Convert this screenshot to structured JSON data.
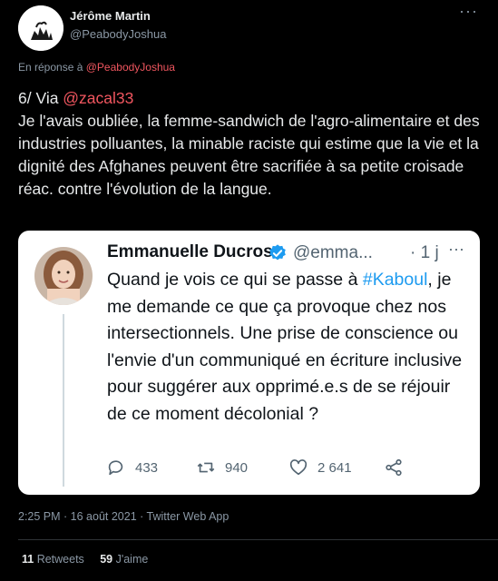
{
  "author": {
    "name": "Jérôme Martin",
    "handle": "@PeabodyJoshua"
  },
  "menu_glyph": "···",
  "reply": {
    "prefix": "En réponse à",
    "to": "@PeabodyJoshua"
  },
  "tweet": {
    "lead": "6/ Via ",
    "mention": "@zacal33",
    "body": "Je l'avais oubliée, la femme-sandwich de l'agro-alimentaire et des industries polluantes, la minable raciste qui estime que la vie et la dignité des Afghanes peuvent être sacrifiée à sa petite croisade réac. contre l'évolution de la langue."
  },
  "quoted": {
    "name": "Emmanuelle Ducros",
    "handle": "@emma...",
    "time": "· 1 j",
    "text_before": "Quand je vois ce qui se passe à ",
    "hashtag": "#Kaboul",
    "text_after": ", je me demande ce que ça provoque chez nos intersectionnels. Une prise de conscience ou l'envie d'un communiqué en écriture inclusive pour suggérer aux opprimé.e.s  de se réjouir de ce moment décolonial ?",
    "replies": "433",
    "retweets": "940",
    "likes": "2 641"
  },
  "meta": "2:25 PM · 16 août 2021 · Twitter Web App",
  "stats": {
    "retweets_count": "11",
    "retweets_label": "Retweets",
    "likes_count": "59",
    "likes_label": "J'aime"
  },
  "colors": {
    "accent": "#f0565f",
    "hashtag": "#1d9bf0",
    "verified": "#1d9bf0"
  },
  "icons": [
    "more-icon",
    "verified-icon",
    "reply-icon",
    "retweet-icon",
    "like-icon",
    "share-icon"
  ]
}
